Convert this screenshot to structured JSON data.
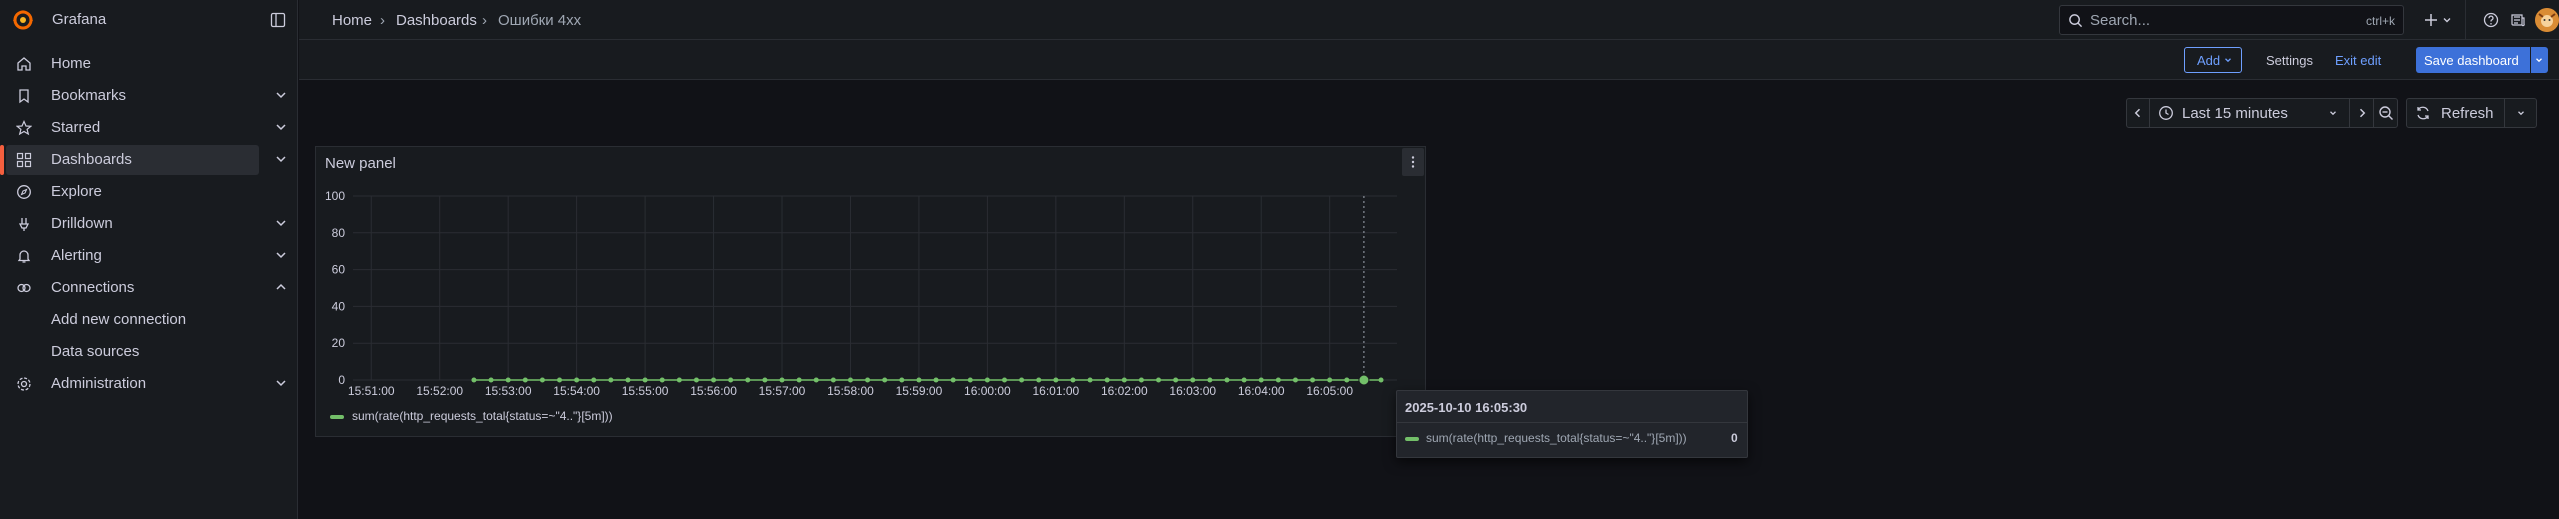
{
  "app": {
    "name": "Grafana"
  },
  "sidebar": {
    "items": [
      {
        "label": "Home",
        "icon": "home-icon",
        "expandable": false
      },
      {
        "label": "Bookmarks",
        "icon": "bookmark-icon",
        "expandable": true
      },
      {
        "label": "Starred",
        "icon": "star-icon",
        "expandable": true
      },
      {
        "label": "Dashboards",
        "icon": "apps-icon",
        "expandable": true,
        "active": true
      },
      {
        "label": "Explore",
        "icon": "compass-icon",
        "expandable": false
      },
      {
        "label": "Drilldown",
        "icon": "drilldown-icon",
        "expandable": true
      },
      {
        "label": "Alerting",
        "icon": "bell-icon",
        "expandable": true
      },
      {
        "label": "Connections",
        "icon": "link-icon",
        "expandable": true,
        "expanded": true
      },
      {
        "label": "Add new connection",
        "sub": true
      },
      {
        "label": "Data sources",
        "sub": true
      },
      {
        "label": "Administration",
        "icon": "cog-icon",
        "expandable": true
      }
    ]
  },
  "breadcrumb": {
    "home": "Home",
    "dashboards": "Dashboards",
    "current": "Ошибки 4xx"
  },
  "search": {
    "placeholder": "Search...",
    "shortcut": "ctrl+k"
  },
  "toolbar": {
    "add_label": "Add",
    "settings_label": "Settings",
    "exit_edit_label": "Exit edit",
    "save_label": "Save dashboard"
  },
  "time_controls": {
    "range_label": "Last 15 minutes",
    "refresh_label": "Refresh"
  },
  "panel": {
    "title": "New panel"
  },
  "colors": {
    "accent": "#3d71d9",
    "series": "#73bf69",
    "active_marker": "#f55f3e"
  },
  "chart_data": {
    "type": "line",
    "title": "New panel",
    "xlabel": "",
    "ylabel": "",
    "ylim": [
      0,
      100
    ],
    "yticks": [
      0,
      20,
      40,
      60,
      80,
      100
    ],
    "xticks": [
      "15:51:00",
      "15:52:00",
      "15:53:00",
      "15:54:00",
      "15:55:00",
      "15:56:00",
      "15:57:00",
      "15:58:00",
      "15:59:00",
      "16:00:00",
      "16:01:00",
      "16:02:00",
      "16:03:00",
      "16:04:00",
      "16:05:00"
    ],
    "series": [
      {
        "name": "sum(rate(http_requests_total{status=~\"4..\"}[5m]))",
        "x": [
          "15:52:30",
          "15:52:45",
          "15:53:00",
          "15:53:15",
          "15:53:30",
          "15:53:45",
          "15:54:00",
          "15:54:15",
          "15:54:30",
          "15:54:45",
          "15:55:00",
          "15:55:15",
          "15:55:30",
          "15:55:45",
          "15:56:00",
          "15:56:15",
          "15:56:30",
          "15:56:45",
          "15:57:00",
          "15:57:15",
          "15:57:30",
          "15:57:45",
          "15:58:00",
          "15:58:15",
          "15:58:30",
          "15:58:45",
          "15:59:00",
          "15:59:15",
          "15:59:30",
          "15:59:45",
          "16:00:00",
          "16:00:15",
          "16:00:30",
          "16:00:45",
          "16:01:00",
          "16:01:15",
          "16:01:30",
          "16:01:45",
          "16:02:00",
          "16:02:15",
          "16:02:30",
          "16:02:45",
          "16:03:00",
          "16:03:15",
          "16:03:30",
          "16:03:45",
          "16:04:00",
          "16:04:15",
          "16:04:30",
          "16:04:45",
          "16:05:00",
          "16:05:15",
          "16:05:30",
          "16:05:45"
        ],
        "values": [
          0,
          0,
          0,
          0,
          0,
          0,
          0,
          0,
          0,
          0,
          0,
          0,
          0,
          0,
          0,
          0,
          0,
          0,
          0,
          0,
          0,
          0,
          0,
          0,
          0,
          0,
          0,
          0,
          0,
          0,
          0,
          0,
          0,
          0,
          0,
          0,
          0,
          0,
          0,
          0,
          0,
          0,
          0,
          0,
          0,
          0,
          0,
          0,
          0,
          0,
          0,
          0,
          0,
          0
        ]
      }
    ],
    "hover": {
      "x": "16:05:30",
      "value": 0
    },
    "legend": "bottom"
  },
  "tooltip": {
    "time": "2025-10-10 16:05:30",
    "series_name": "sum(rate(http_requests_total{status=~\"4..\"}[5m]))",
    "value": "0"
  }
}
